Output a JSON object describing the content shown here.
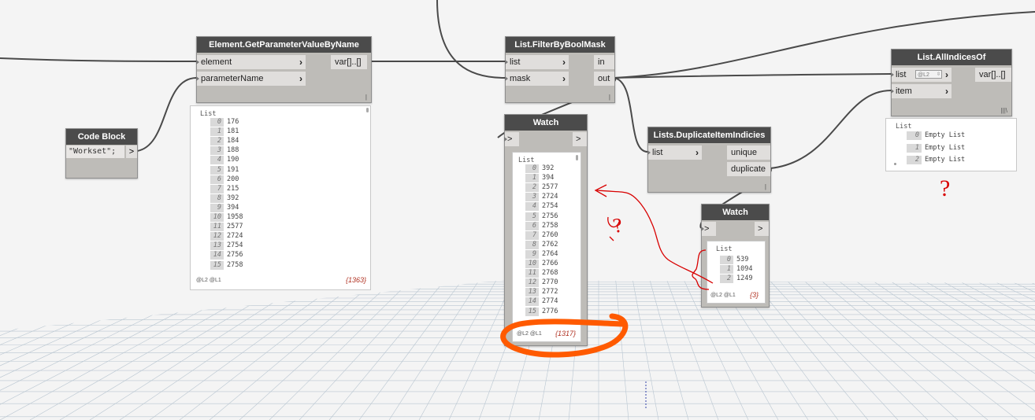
{
  "nodes": {
    "get_param": {
      "title": "Element.GetParameterValueByName",
      "inputs": [
        "element",
        "parameterName"
      ],
      "output": "var[]..[]"
    },
    "code_block": {
      "title": "Code Block",
      "code": "\"Workset\";",
      "output": ">"
    },
    "filter": {
      "title": "List.FilterByBoolMask",
      "inputs": [
        "list",
        "mask"
      ],
      "outputs": [
        "in",
        "out"
      ]
    },
    "watch1": {
      "title": "Watch",
      "input": ">",
      "output": ">"
    },
    "dup": {
      "title": "Lists.DuplicateItemIndicies",
      "inputs": [
        "list"
      ],
      "outputs": [
        "unique",
        "duplicate"
      ]
    },
    "watch2": {
      "title": "Watch",
      "input": ">",
      "output": ">"
    },
    "all_indices": {
      "title": "List.AllIndicesOf",
      "inputs": [
        "list",
        "item"
      ],
      "output": "var[]..[]",
      "list_level": "@L2"
    }
  },
  "preview_getparam": {
    "header": "List",
    "rows": [
      {
        "i": "0",
        "v": "176"
      },
      {
        "i": "1",
        "v": "181"
      },
      {
        "i": "2",
        "v": "184"
      },
      {
        "i": "3",
        "v": "188"
      },
      {
        "i": "4",
        "v": "190"
      },
      {
        "i": "5",
        "v": "191"
      },
      {
        "i": "6",
        "v": "200"
      },
      {
        "i": "7",
        "v": "215"
      },
      {
        "i": "8",
        "v": "392"
      },
      {
        "i": "9",
        "v": "394"
      },
      {
        "i": "10",
        "v": "1958"
      },
      {
        "i": "11",
        "v": "2577"
      },
      {
        "i": "12",
        "v": "2724"
      },
      {
        "i": "13",
        "v": "2754"
      },
      {
        "i": "14",
        "v": "2756"
      },
      {
        "i": "15",
        "v": "2758"
      }
    ],
    "levels": "@L2 @L1",
    "count": "{1363}"
  },
  "watch1_data": {
    "header": "List",
    "rows": [
      {
        "i": "0",
        "v": "392"
      },
      {
        "i": "1",
        "v": "394"
      },
      {
        "i": "2",
        "v": "2577"
      },
      {
        "i": "3",
        "v": "2724"
      },
      {
        "i": "4",
        "v": "2754"
      },
      {
        "i": "5",
        "v": "2756"
      },
      {
        "i": "6",
        "v": "2758"
      },
      {
        "i": "7",
        "v": "2760"
      },
      {
        "i": "8",
        "v": "2762"
      },
      {
        "i": "9",
        "v": "2764"
      },
      {
        "i": "10",
        "v": "2766"
      },
      {
        "i": "11",
        "v": "2768"
      },
      {
        "i": "12",
        "v": "2770"
      },
      {
        "i": "13",
        "v": "2772"
      },
      {
        "i": "14",
        "v": "2774"
      },
      {
        "i": "15",
        "v": "2776"
      }
    ],
    "levels": "@L2 @L1",
    "count": "{1317}"
  },
  "watch2_data": {
    "header": "List",
    "rows": [
      {
        "i": "0",
        "v": "539"
      },
      {
        "i": "1",
        "v": "1094"
      },
      {
        "i": "2",
        "v": "1249"
      }
    ],
    "levels": "@L2 @L1",
    "count": "{3}"
  },
  "preview_allindices": {
    "header": "List",
    "rows": [
      {
        "i": "0",
        "v": "Empty List"
      },
      {
        "i": "1",
        "v": "Empty List"
      },
      {
        "i": "2",
        "v": "Empty List"
      }
    ]
  },
  "annotations": {
    "q1": "?",
    "q2": "?"
  },
  "colors": {
    "annotation": "#d80000",
    "highlight": "#ff5a00",
    "node_header": "#4b4b4b",
    "node_body": "#bebcb8"
  }
}
